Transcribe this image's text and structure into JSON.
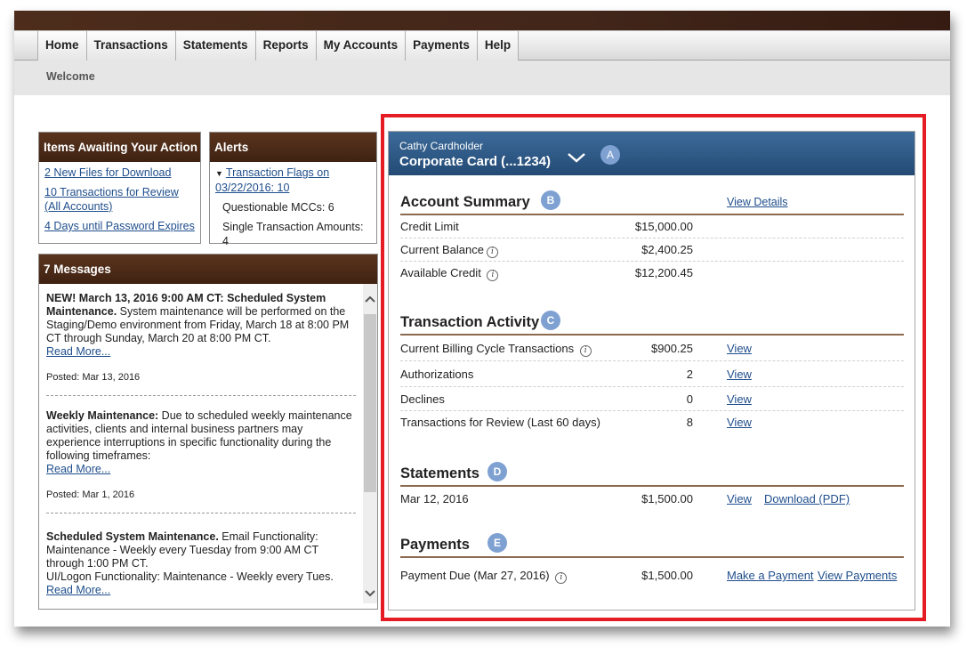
{
  "nav": {
    "tabs": [
      "Home",
      "Transactions",
      "Statements",
      "Reports",
      "My Accounts",
      "Payments",
      "Help"
    ],
    "breadcrumb": "Welcome"
  },
  "items_awaiting": {
    "title": "Items Awaiting Your Action",
    "links": [
      "2 New Files for Download",
      "10 Transactions for Review (All Accounts)",
      "4 Days until Password Expires"
    ]
  },
  "alerts": {
    "title": "Alerts",
    "flag_link": "Transaction Flags on 03/22/2016: 10",
    "rows": [
      "Questionable MCCs: 6",
      "Single Transaction Amounts: 4"
    ]
  },
  "messages": {
    "title": "7 Messages",
    "read_more": "Read More...",
    "items": [
      {
        "bold": "NEW! March 13, 2016 9:00 AM CT: Scheduled System Maintenance.",
        "text": " System maintenance will be performed on the Staging/Demo environment from Friday, March 18 at 8:00 PM CT through Sunday, March 20 at 8:00 PM CT.",
        "posted": "Posted: Mar 13, 2016"
      },
      {
        "bold": "Weekly Maintenance:",
        "text": " Due to scheduled weekly maintenance activities, clients and internal business partners may experience interruptions in specific functionality during the following timeframes:",
        "posted": "Posted: Mar 1, 2016"
      },
      {
        "bold": "Scheduled System Maintenance.",
        "text": "  Email Functionality: Maintenance - Weekly every Tuesday from 9:00 AM CT through 1:00 PM CT.",
        "text2": "UI/Logon Functionality: Maintenance - Weekly every Tues."
      }
    ]
  },
  "account": {
    "holder": "Cathy Cardholder",
    "card": "Corporate Card (...1234)",
    "badges": [
      "A",
      "B",
      "C",
      "D",
      "E"
    ],
    "summary": {
      "title": "Account Summary",
      "view_details": "View Details",
      "rows": [
        {
          "label": "Credit Limit",
          "value": "$15,000.00"
        },
        {
          "label": "Current Balance",
          "value": "$2,400.25"
        },
        {
          "label": "Available Credit",
          "value": "$12,200.45"
        }
      ]
    },
    "activity": {
      "title": "Transaction Activity",
      "view": "View",
      "rows": [
        {
          "label": "Current Billing Cycle Transactions",
          "value": "$900.25"
        },
        {
          "label": "Authorizations",
          "value": "2"
        },
        {
          "label": "Declines",
          "value": "0"
        },
        {
          "label": "Transactions for Review (Last 60 days)",
          "value": "8"
        }
      ]
    },
    "statements": {
      "title": "Statements",
      "date": "Mar 12, 2016",
      "amount": "$1,500.00",
      "view": "View",
      "download": "Download (PDF)"
    },
    "payments": {
      "title": "Payments",
      "label": "Payment Due (Mar 27, 2016)",
      "amount": "$1,500.00",
      "make": "Make a Payment",
      "view": "View Payments"
    }
  },
  "colors": {
    "brown_header": "#4d2c1b",
    "blue_header": "#2c5782",
    "badge": "#7ea1d2",
    "highlight": "#e51c23",
    "link": "#1f4e8c",
    "section_rule": "#8c6a4f"
  }
}
